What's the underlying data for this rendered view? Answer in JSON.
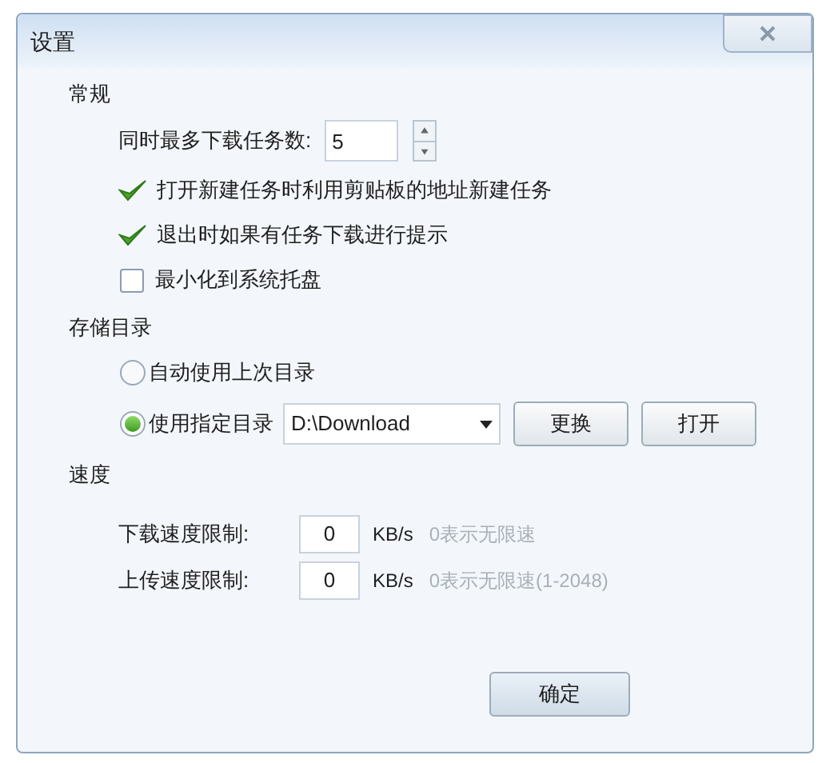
{
  "window": {
    "title": "设置"
  },
  "general": {
    "heading": "常规",
    "max_tasks": {
      "label": "同时最多下载任务数:",
      "value": "5"
    },
    "options": [
      {
        "label": "打开新建任务时利用剪贴板的地址新建任务",
        "checked": true
      },
      {
        "label": "退出时如果有任务下载进行提示",
        "checked": true
      },
      {
        "label": "最小化到系统托盘",
        "checked": false
      }
    ]
  },
  "storage": {
    "heading": "存储目录",
    "choices": [
      {
        "label": "自动使用上次目录",
        "selected": false
      },
      {
        "label": "使用指定目录",
        "selected": true
      }
    ],
    "directory": "D:\\Download",
    "buttons": [
      "更换",
      "打开"
    ]
  },
  "speed": {
    "heading": "速度",
    "limits": [
      {
        "label": "下载速度限制:",
        "value": "0",
        "unit": "KB/s",
        "hint": "0表示无限速"
      },
      {
        "label": "上传速度限制:",
        "value": "0",
        "unit": "KB/s",
        "hint": "0表示无限速(1-2048)"
      }
    ]
  },
  "footer": {
    "ok": "确定"
  }
}
